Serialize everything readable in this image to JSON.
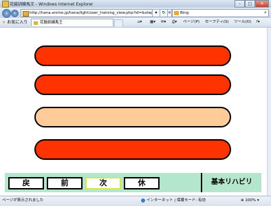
{
  "window": {
    "title": "花鼓訓練馬王 - Windows Internet Explorer",
    "minimize": "–",
    "maximize": "□",
    "close": "✕"
  },
  "address": {
    "url": "http://hana.animo.jp/hana/light/user_training_view.php?id=&step=",
    "search_placeholder": "Bing",
    "search_icon": "⌕"
  },
  "favorites": {
    "button_label": "お気に入り",
    "tab_label": "花鼓訓練馬王",
    "commands": [
      "ページ(P)",
      "セーフティ(S)",
      "ツール(O)"
    ]
  },
  "bars": [
    {
      "state": "red"
    },
    {
      "state": "red"
    },
    {
      "state": "peach"
    },
    {
      "state": "red"
    }
  ],
  "nav_buttons": {
    "back": "戻",
    "prev": "前",
    "next": "次",
    "rest": "休"
  },
  "program_label": "基本リハビリ",
  "status": {
    "text": "ページが表示されました",
    "zone": "インターネット | 保護モード: 有効",
    "zoom": "100%"
  },
  "colors": {
    "bar_red": "#ff3300",
    "bar_peach": "#ffcc99",
    "panel_green": "#b3e6cc",
    "active_outline": "#d4e84e"
  }
}
